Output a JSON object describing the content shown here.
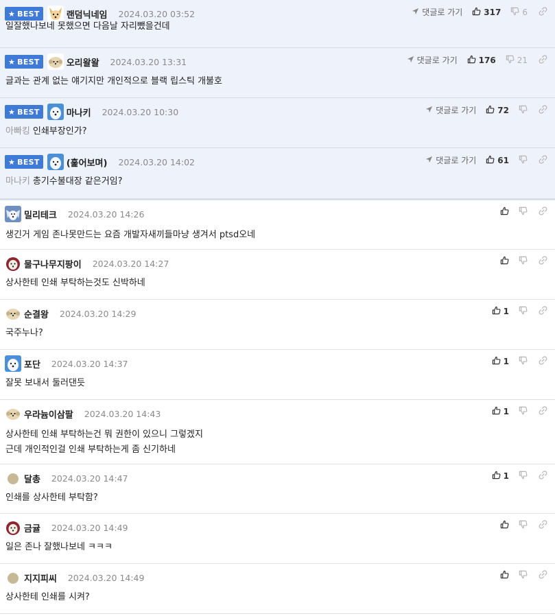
{
  "reply_label": "댓글로 가기",
  "badge_label": "BEST",
  "comments": [
    {
      "best": true,
      "avatar": "dog-face",
      "nick": "랜덤닉네임",
      "date": "2024.03.20 03:52",
      "up": "317",
      "down": "6",
      "quote": "",
      "text": "일잘했나보네 못했으면 다음날 자리뺐을건데"
    },
    {
      "best": true,
      "avatar": "round-pup",
      "nick": "오리왈왈",
      "date": "2024.03.20 13:31",
      "up": "176",
      "down": "21",
      "quote": "",
      "text": "글과는 관계 없는 얘기지만 개인적으로 블랙 립스틱 개불호"
    },
    {
      "best": true,
      "avatar": "white-dog",
      "nick": "마나키",
      "date": "2024.03.20 10:30",
      "up": "72",
      "down": "",
      "quote": "아빠킹",
      "text": "인쇄부장인가?"
    },
    {
      "best": true,
      "avatar": "white-dog",
      "nick": "(훑어보며)",
      "date": "2024.03.20 14:02",
      "up": "61",
      "down": "",
      "quote": "마나키",
      "text": "총기수불대장 같은거임?"
    },
    {
      "best": false,
      "avatar": "blue-dog",
      "nick": "밀리테크",
      "date": "2024.03.20 14:26",
      "up": "",
      "down": "",
      "quote": "",
      "text": "생긴거 게임 존나못만드는 요즘 개발자새끼들마냥 생겨서 ptsd오네"
    },
    {
      "best": false,
      "avatar": "red-dog",
      "nick": "물구나무지팡이",
      "date": "2024.03.20 14:27",
      "up": "",
      "down": "",
      "quote": "",
      "text": "상사한테 인쇄 부탁하는것도 신박하네"
    },
    {
      "best": false,
      "avatar": "round-pup",
      "nick": "순결왕",
      "date": "2024.03.20 14:29",
      "up": "1",
      "down": "",
      "quote": "",
      "text": "국주누나?"
    },
    {
      "best": false,
      "avatar": "white-dog",
      "nick": "포단",
      "date": "2024.03.20 14:37",
      "up": "1",
      "down": "",
      "quote": "",
      "text": "잘못 보내서 둘러댄듯"
    },
    {
      "best": false,
      "avatar": "round-pup",
      "nick": "우라늄이삼팔",
      "date": "2024.03.20 14:43",
      "up": "1",
      "down": "",
      "quote": "",
      "text": "상사한테 인쇄 부탁하는건 뭐 권한이 있으니 그렇겠지\n근데 개인적인걸 인쇄 부탁하는게 좀 신기하네"
    },
    {
      "best": false,
      "avatar": "beige-dot",
      "nick": "달총",
      "date": "2024.03.20 14:47",
      "up": "1",
      "down": "",
      "quote": "",
      "text": "인쇄를 상사한테 부탁함?"
    },
    {
      "best": false,
      "avatar": "red-dog",
      "nick": "금귤",
      "date": "2024.03.20 14:49",
      "up": "",
      "down": "",
      "quote": "",
      "text": "일은 존나 잘했나보네 ㅋㅋㅋ"
    },
    {
      "best": false,
      "avatar": "beige-dot",
      "nick": "지지피씨",
      "date": "2024.03.20 14:49",
      "up": "",
      "down": "",
      "quote": "",
      "text": "상사한테 인쇄를 시켜?"
    }
  ]
}
